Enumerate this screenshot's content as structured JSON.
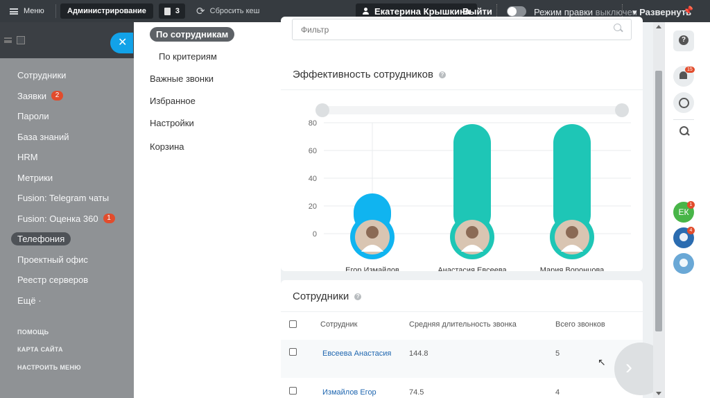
{
  "topbar": {
    "menu_label": "Меню",
    "admin_label": "Администрирование",
    "count": "3",
    "reset_cache": "Сбросить кеш",
    "user_name": "Екатерина Крышкина",
    "exit": "Выйти",
    "edit_mode": "Режим правки",
    "edit_mode_state": "выключен",
    "expand": "Развернуть"
  },
  "sidebar": {
    "items": [
      {
        "label": "Сотрудники"
      },
      {
        "label": "Заявки",
        "badge": "2"
      },
      {
        "label": "Пароли"
      },
      {
        "label": "База знаний"
      },
      {
        "label": "HRM"
      },
      {
        "label": "Метрики"
      },
      {
        "label": "Fusion: Telegram чаты"
      },
      {
        "label": "Fusion: Оценка 360",
        "badge": "1"
      },
      {
        "label": "Телефония",
        "active": true
      },
      {
        "label": "Проектный офис"
      },
      {
        "label": "Реестр серверов"
      },
      {
        "label": "Ещё ·"
      }
    ],
    "footer": [
      "ПОМОЩЬ",
      "КАРТА САЙТА",
      "НАСТРОИТЬ МЕНЮ"
    ]
  },
  "subnav": {
    "active": "По сотрудникам",
    "criteria": "По критериям",
    "important_calls": "Важные звонки",
    "favorites": "Избранное",
    "settings": "Настройки",
    "trash": "Корзина"
  },
  "filter": {
    "placeholder": "Фильтр"
  },
  "chart_section": {
    "title": "Эффективность сотрудников"
  },
  "chart_data": {
    "type": "bar",
    "categories": [
      "Егор Измайлов",
      "Анастасия Евсеева",
      "Мария Воронцова"
    ],
    "values": [
      29,
      79,
      79
    ],
    "ylim": [
      0,
      80
    ],
    "yticks": [
      0,
      20,
      40,
      60,
      80
    ],
    "colors": [
      "#10b4f0",
      "#1ec6b6",
      "#1ec6b6"
    ],
    "grid": "vertical-at-first-bar"
  },
  "table": {
    "title": "Сотрудники",
    "headers": [
      "Сотрудник",
      "Средняя длительность звонка",
      "Всего звонков"
    ],
    "rows": [
      {
        "name": "Евсеева Анастасия",
        "avg": "144.8",
        "total": "5"
      },
      {
        "name": "Измайлов Егор",
        "avg": "74.5",
        "total": "4"
      }
    ]
  },
  "right_panel": {
    "notifications_badge": "15",
    "avatar_initials": "ЕК",
    "avatar_badge": "1",
    "group_badge": "4"
  }
}
